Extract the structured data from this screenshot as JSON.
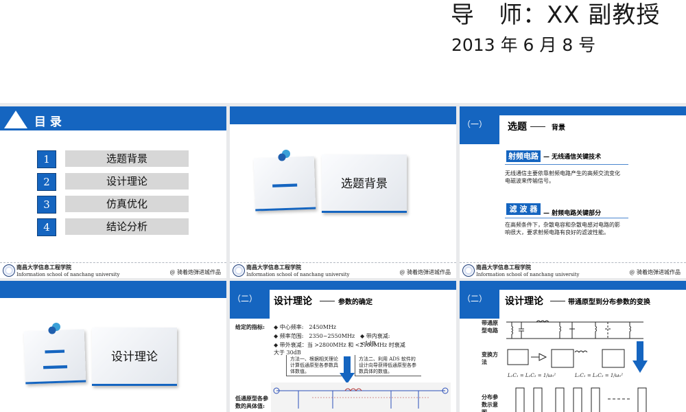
{
  "header": {
    "advisor": "导　师：XX 副教授",
    "date": "2013 年 6 月 8 号"
  },
  "footer": {
    "university_cn": "南昌大学信息工程学院",
    "university_en": "Information school of  nanchang university",
    "credit": "@ 骑着炮弹进城作品"
  },
  "slide_toc": {
    "title": "目 录",
    "items": [
      {
        "num": "1",
        "label": "选题背景"
      },
      {
        "num": "2",
        "label": "设计理论"
      },
      {
        "num": "3",
        "label": "仿真优化"
      },
      {
        "num": "4",
        "label": "结论分析"
      }
    ]
  },
  "slide_sec1": {
    "num": "一",
    "title": "选题背景"
  },
  "slide_bg": {
    "section_mark": "（一）",
    "title": "选题",
    "subtitle": "背景",
    "chip1": "射频电路",
    "chip1_note": "无线通信关键技术",
    "para1": "无线通信主要依靠射频电路产生的高频交流变化电磁波来传输信号。",
    "chip2": "滤 波 器",
    "chip2_note": "射频电路关键部分",
    "para2": "在高频条件下，杂散电容和杂散电感对电路的影响很大，要求射频电路有良好的滤波性能。"
  },
  "slide_sec2": {
    "num": "二",
    "title": "设计理论"
  },
  "slide_params": {
    "section_mark": "（二）",
    "title": "设计理论",
    "subtitle": "参数的确定",
    "given_label": "给定的指标:",
    "spec1": "中心频率:　2450MHz",
    "spec2": "频率范围:　2350~2550MHz",
    "spec3": "带内衰减:　<1dB",
    "spec4": "带外衰减：当 >2800MHz 和 <2100MHz 时衰减大于 30dB",
    "method1": "方法一、根据相关理论计算低通原型各参数具体数值。",
    "method2": "方法二、利用 ADS 软件的设计向导获得低通原型各参数具体的数值。",
    "lowpass_label": "低通原型各参数的具体值:"
  },
  "slide_transform": {
    "section_mark": "（二）",
    "title": "设计理论",
    "subtitle": "带通原型到分布参数的变换",
    "label_bandpass": "带通原型电路",
    "label_method": "变换方法",
    "formula1": "L₁C₁ = L₂C₂ = 1/ω₀²",
    "formula2": "L₁C₁ = L₂C₂ = 1/ω₀²",
    "label_dist": "分布参数示意图"
  },
  "colors": {
    "accent": "#1565c0",
    "background": "#e9eaec"
  }
}
